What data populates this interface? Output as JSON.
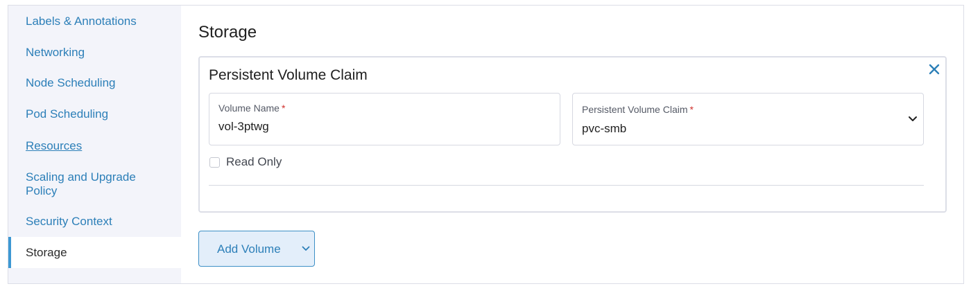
{
  "sidebar": {
    "items": [
      {
        "label": "Labels & Annotations"
      },
      {
        "label": "Networking"
      },
      {
        "label": "Node Scheduling"
      },
      {
        "label": "Pod Scheduling"
      },
      {
        "label": "Resources"
      },
      {
        "label": "Scaling and Upgrade Policy"
      },
      {
        "label": "Security Context"
      },
      {
        "label": "Storage",
        "active": true
      }
    ]
  },
  "main": {
    "title": "Storage",
    "card": {
      "title": "Persistent Volume Claim",
      "volume_name": {
        "label": "Volume Name",
        "required_mark": "*",
        "value": "vol-3ptwg"
      },
      "pvc": {
        "label": "Persistent Volume Claim",
        "required_mark": "*",
        "value": "pvc-smb"
      },
      "read_only": {
        "label": "Read Only",
        "checked": false
      }
    },
    "add_volume_label": "Add Volume"
  },
  "colors": {
    "accent": "#2c7fb8",
    "active_indicator": "#3d98d3",
    "sidebar_bg": "#f3f4fa",
    "required": "#d0312d",
    "button_bg": "#e3eefa"
  },
  "icons": {
    "close": "close-icon",
    "select": "chevron-down-icon",
    "add_volume_dropdown": "chevron-down-icon"
  }
}
